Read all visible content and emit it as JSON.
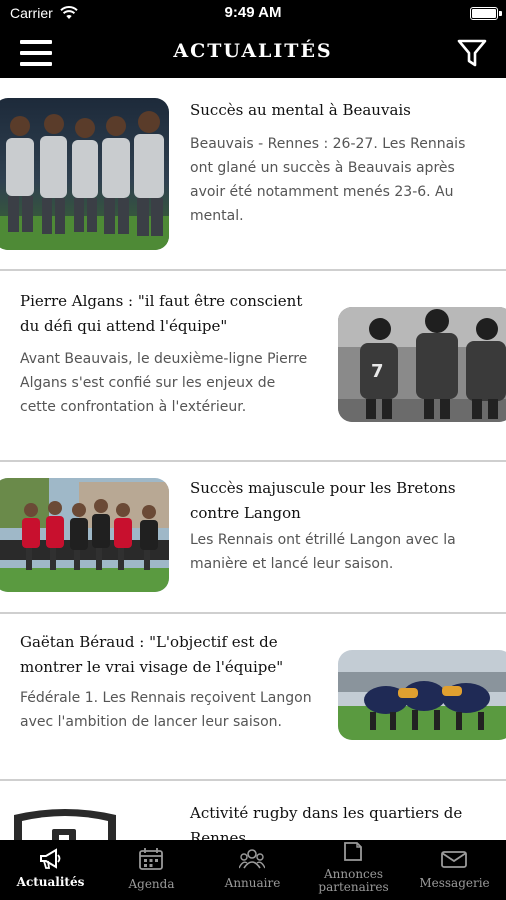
{
  "status_bar": {
    "carrier": "Carrier",
    "time": "9:49 AM"
  },
  "nav": {
    "title": "ACTUALITÉS"
  },
  "articles": [
    {
      "title": "Succès au mental à Beauvais",
      "summary": "Beauvais - Rennes : 26-27. Les Rennais ont glané un succès à Beauvais après avoir été notamment menés 23-6. Au mental."
    },
    {
      "title": "Pierre Algans : \"il faut être conscient du défi qui attend l'équipe\"",
      "summary": "Avant Beauvais, le deuxième-ligne Pierre Algans s'est confié sur les enjeux de cette confrontation à l'extérieur."
    },
    {
      "title": "Succès majuscule pour les Bretons contre Langon",
      "summary": "Les Rennais ont étrillé Langon avec la manière et lancé leur saison."
    },
    {
      "title": "Gaëtan Béraud : \"L'objectif est de montrer le vrai visage de l'équipe\"",
      "summary": "Fédérale 1. Les Rennais reçoivent Langon avec l'ambition de lancer leur saison."
    },
    {
      "title": "Activité rugby dans les quartiers de Rennes",
      "summary": ""
    }
  ],
  "tabs": [
    {
      "label": "Actualités",
      "icon": "megaphone-icon",
      "active": true
    },
    {
      "label": "Agenda",
      "icon": "calendar-icon",
      "active": false
    },
    {
      "label": "Annuaire",
      "icon": "people-icon",
      "active": false
    },
    {
      "label": "Annonces partenaires",
      "icon": "document-icon",
      "active": false
    },
    {
      "label": "Messagerie",
      "icon": "envelope-icon",
      "active": false
    }
  ]
}
